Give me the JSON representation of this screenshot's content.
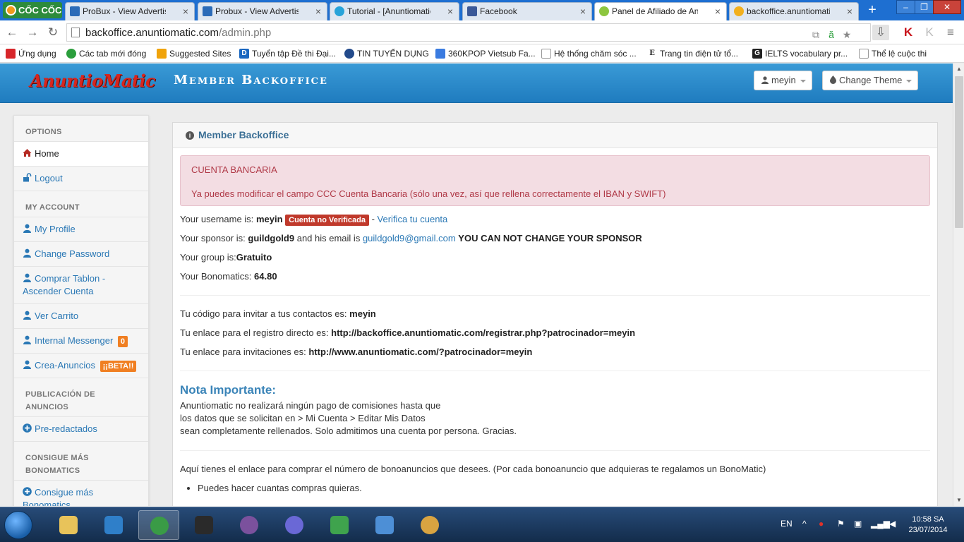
{
  "browser": {
    "logo_text": "CỐC CỐC",
    "tabs": [
      {
        "label": "ProBux - View Advertisem",
        "color": "#2b6bb8"
      },
      {
        "label": "Probux - View Advertisem",
        "color": "#2b6bb8"
      },
      {
        "label": "Tutorial - [Anuntiomatic.c",
        "color": "#27a3d9"
      },
      {
        "label": "Facebook",
        "color": "#3b5998"
      },
      {
        "label": "Panel de Afiliado de Anun",
        "color": "#8dc63f"
      },
      {
        "label": "backoffice.anuntiomatic.c",
        "color": "#f2b01e"
      }
    ],
    "new_tab": "+",
    "url_host": "backoffice.anuntiomatic.com",
    "url_path": "/admin.php",
    "bookmarks": [
      {
        "label": "Ứng dụng",
        "color": "#d7262a"
      },
      {
        "label": "Các tab mới đóng",
        "color": "#2b9e3c"
      },
      {
        "label": "Suggested Sites",
        "color": "#f0a30a"
      },
      {
        "label": "Tuyển tập Đề thi Đại...",
        "color": "#1a67c0"
      },
      {
        "label": "TIN TUYỂN DỤNG",
        "color": "#224a8b"
      },
      {
        "label": "360KPOP Vietsub Fa...",
        "color": "#3a7be0"
      },
      {
        "label": "Hệ thống chăm sóc ...",
        "color": "#bbbbbb"
      },
      {
        "label": "Trang tin điện tử tổ...",
        "color": "#222222"
      },
      {
        "label": "IELTS vocabulary pr...",
        "color": "#222222"
      },
      {
        "label": "Thể lệ cuộc thi",
        "color": "#bbbbbb"
      }
    ]
  },
  "header": {
    "brand": "AnuntioMatic",
    "subtitle": "Member Backoffice",
    "user_button": "meyin",
    "theme_button": "Change Theme"
  },
  "sidebar": {
    "sections": [
      {
        "title": "OPTIONS",
        "items": [
          {
            "label": "Home",
            "active": true,
            "icon": "home-icon"
          },
          {
            "label": "Logout",
            "icon": "unlock-icon"
          }
        ]
      },
      {
        "title": "MY ACCOUNT",
        "items": [
          {
            "label": "My Profile",
            "icon": "user-icon"
          },
          {
            "label": "Change Password",
            "icon": "user-icon"
          },
          {
            "label": "Comprar Tablon - Ascender Cuenta",
            "icon": "user-icon"
          },
          {
            "label": "Ver Carrito",
            "icon": "user-icon"
          },
          {
            "label": "Internal Messenger",
            "icon": "user-icon",
            "badge": "0"
          },
          {
            "label": "Crea-Anuncios",
            "icon": "user-icon",
            "badge": "¡¡BETA!!"
          }
        ]
      },
      {
        "title": "PUBLICACIÓN DE ANUNCIOS",
        "items": [
          {
            "label": "Pre-redactados",
            "icon": "plus-circle-icon"
          }
        ]
      },
      {
        "title": "CONSIGUE MÁS BONOMATICS",
        "items": [
          {
            "label": "Consigue más Bonomatics",
            "icon": "plus-circle-icon"
          }
        ]
      }
    ]
  },
  "main": {
    "panel_title": "Member Backoffice",
    "alert_title": "CUENTA BANCARIA",
    "alert_message": "Ya puedes modificar el campo CCC Cuenta Bancaria (sólo una vez, así que rellena correctamente el IBAN y SWIFT)",
    "username_label": "Your username is:",
    "username": "meyin",
    "unverified_badge": "Cuenta no Verificada",
    "separator": "-",
    "verify_link": "Verifica tu cuenta",
    "sponsor_label": "Your sponsor is:",
    "sponsor": "guildgold9",
    "sponsor_email_label": "and his email is",
    "sponsor_email": "guildgold9@gmail.com",
    "sponsor_warning": "YOU CAN NOT CHANGE YOUR SPONSOR",
    "group_label": "Your group is:",
    "group": "Gratuito",
    "bonomatics_label": "Your Bonomatics:",
    "bonomatics": "64.80",
    "invite_code_label": "Tu código para invitar a tus contactos es:",
    "invite_code": "meyin",
    "direct_link_label": "Tu enlace para el registro directo es:",
    "direct_link": "http://backoffice.anuntiomatic.com/registrar.php?patrocinador=meyin",
    "invite_link_label": "Tu enlace para invitaciones es:",
    "invite_link": "http://www.anuntiomatic.com/?patrocinador=meyin",
    "nota_title": "Nota Importante:",
    "nota_lines": [
      "Anuntiomatic no realizará ningún pago de comisiones hasta que",
      "los datos que se solicitan en > Mi Cuenta > Editar Mis Datos",
      "sean completamente rellenados. Solo admitimos una cuenta por persona. Gracias."
    ],
    "buy_text": "Aquí tienes el enlace para comprar el número de bonoanuncios que desees. (Por cada bonoanuncio que adquieras te regalamos un BonoMatic)",
    "buy_bullet": "Puedes hacer cuantas compras quieras."
  },
  "taskbar": {
    "language": "EN",
    "time": "10:58 SA",
    "date": "23/07/2014"
  }
}
